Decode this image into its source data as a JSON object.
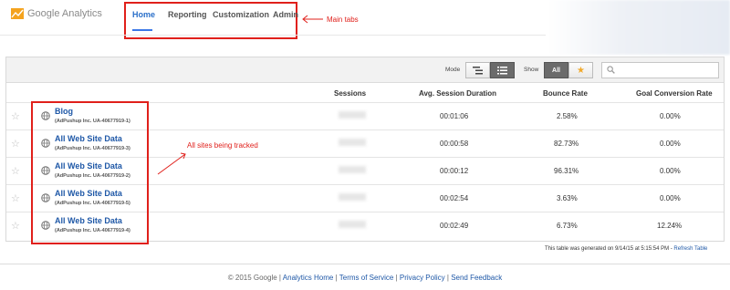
{
  "brand": {
    "name": "Google Analytics"
  },
  "tabs": [
    {
      "label": "Home",
      "active": true
    },
    {
      "label": "Reporting",
      "active": false
    },
    {
      "label": "Customization",
      "active": false
    },
    {
      "label": "Admin",
      "active": false
    }
  ],
  "annotations": {
    "main_tabs": "Main tabs",
    "sites_tracked": "All sites being tracked"
  },
  "toolbar": {
    "mode_label": "Mode",
    "show_label": "Show",
    "show_all": "All",
    "search_placeholder": ""
  },
  "table": {
    "columns": [
      "Sessions",
      "Avg. Session Duration",
      "Bounce Rate",
      "Goal Conversion Rate"
    ],
    "rows": [
      {
        "name": "Blog",
        "account": "(AdPushup Inc. UA-40677919-1)",
        "duration": "00:01:06",
        "bounce": "2.58%",
        "goal": "0.00%"
      },
      {
        "name": "All Web Site Data",
        "account": "(AdPushup Inc. UA-40677919-3)",
        "duration": "00:00:58",
        "bounce": "82.73%",
        "goal": "0.00%"
      },
      {
        "name": "All Web Site Data",
        "account": "(AdPushup Inc. UA-40677919-2)",
        "duration": "00:00:12",
        "bounce": "96.31%",
        "goal": "0.00%"
      },
      {
        "name": "All Web Site Data",
        "account": "(AdPushup Inc. UA-40677919-5)",
        "duration": "00:02:54",
        "bounce": "3.63%",
        "goal": "0.00%"
      },
      {
        "name": "All Web Site Data",
        "account": "(AdPushup Inc. UA-40677919-4)",
        "duration": "00:02:49",
        "bounce": "6.73%",
        "goal": "12.24%"
      }
    ]
  },
  "generated": {
    "text": "This table was generated on 9/14/15 at 5:15:54 PM - ",
    "refresh": "Refresh Table"
  },
  "footer": {
    "copyright": "© 2015 Google",
    "links": [
      "Analytics Home",
      "Terms of Service",
      "Privacy Policy",
      "Send Feedback"
    ]
  },
  "colors": {
    "accent": "#e0201b",
    "link": "#1f58a7",
    "tab_active": "#2a6fc9"
  }
}
